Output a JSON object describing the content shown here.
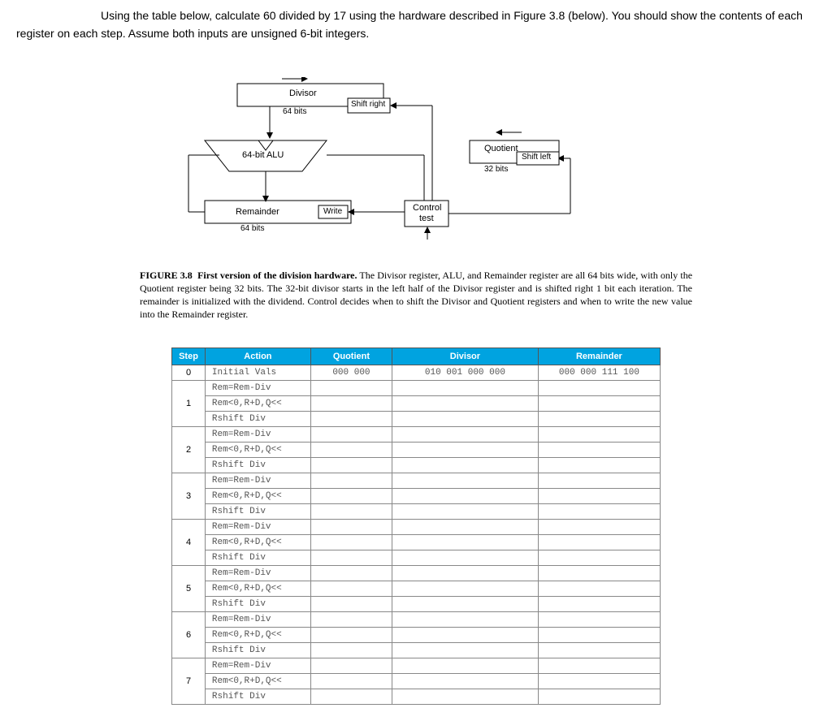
{
  "prompt": {
    "line1": "Using the table below, calculate 60 divided by 17 using the hardware described in Figure 3.8 (below). You should show the contents of each",
    "line2": "register on each step. Assume both inputs are unsigned 6-bit integers."
  },
  "diagram": {
    "divisor": "Divisor",
    "shift_right": "Shift right",
    "div_bits": "64 bits",
    "alu": "64-bit ALU",
    "remainder": "Remainder",
    "write": "Write",
    "rem_bits": "64 bits",
    "quotient": "Quotient",
    "shift_left": "Shift left",
    "quot_bits": "32 bits",
    "control1": "Control",
    "control2": "test"
  },
  "caption": {
    "lead": "FIGURE 3.8",
    "bold": "First version of the division hardware.",
    "rest": " The Divisor register, ALU, and Remainder register are all 64 bits wide, with only the Quotient register being 32 bits. The 32-bit divisor starts in the left half of the Divisor register and is shifted right 1 bit each iteration. The remainder is initialized with the dividend. Control decides when to shift the Divisor and Quotient registers and when to write the new value into the Remainder register."
  },
  "table": {
    "headers": {
      "step": "Step",
      "action": "Action",
      "quotient": "Quotient",
      "divisor": "Divisor",
      "remainder": "Remainder"
    },
    "initial": {
      "step": "0",
      "action": "Initial Vals",
      "quotient": "000 000",
      "divisor": "010 001 000 000",
      "remainder": "000 000 111 100"
    },
    "actions": {
      "a1": "Rem=Rem-Div",
      "a2": "Rem<0,R+D,Q<<",
      "a3": "Rshift Div"
    },
    "steps": [
      "1",
      "2",
      "3",
      "4",
      "5",
      "6",
      "7"
    ]
  }
}
